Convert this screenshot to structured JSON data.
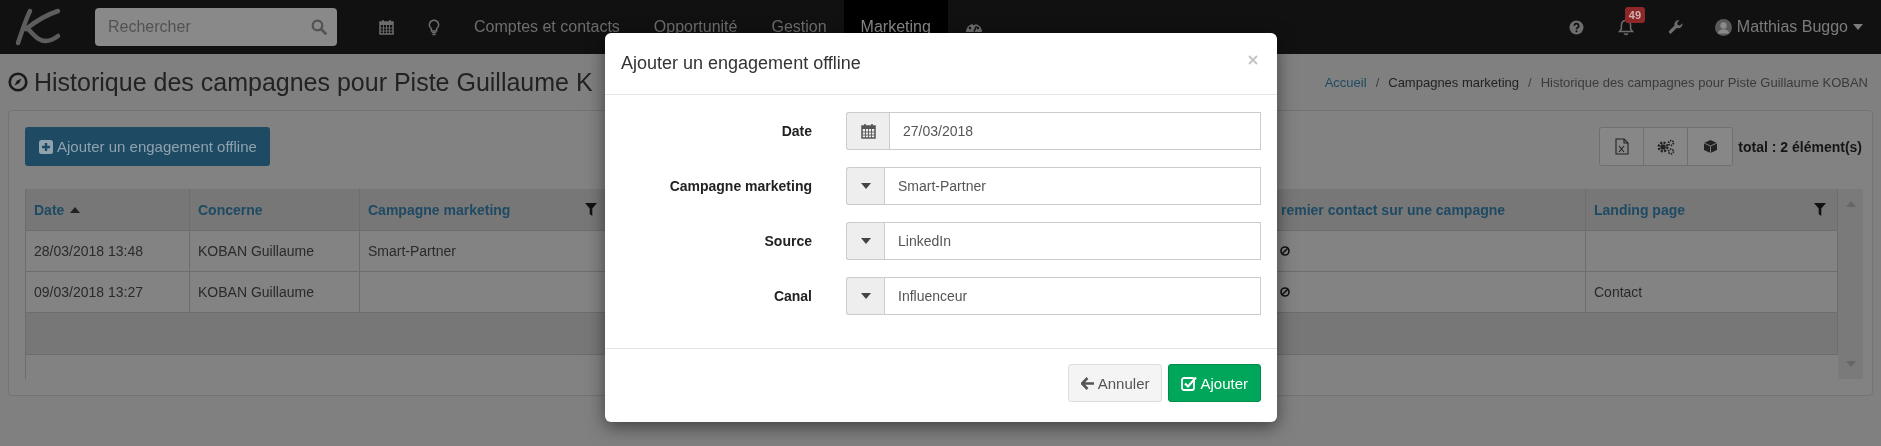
{
  "navbar": {
    "search": {
      "placeholder": "Rechercher"
    },
    "menu": [
      {
        "label": "Comptes et contacts",
        "selected": false
      },
      {
        "label": "Opportunité",
        "selected": false
      },
      {
        "label": "Gestion",
        "selected": false
      },
      {
        "label": "Marketing",
        "selected": true
      }
    ],
    "notifications": "49",
    "user": "Matthias Buggo"
  },
  "page": {
    "title": "Historique des campagnes pour Piste Guillaume K",
    "breadcrumb_separator": "/",
    "breadcrumb": [
      {
        "label": "Accueil",
        "kind": "link"
      },
      {
        "label": "Campagnes marketing",
        "kind": "hover"
      },
      {
        "label": "Historique des campagnes pour Piste Guillaume KOBAN",
        "kind": "current"
      }
    ]
  },
  "toolbar": {
    "add_button": "Ajouter un engagement offline",
    "total": "total : 2 élément(s)"
  },
  "table": {
    "columns": [
      {
        "label": "Date",
        "sorted": true,
        "filter": false
      },
      {
        "label": "Concerne",
        "sorted": false,
        "filter": false
      },
      {
        "label": "Campagne marketing",
        "sorted": false,
        "filter": true
      },
      {
        "label": "remier contact sur une campagne",
        "sorted": false,
        "filter": false
      },
      {
        "label": "Landing page",
        "sorted": false,
        "filter": true
      }
    ],
    "rows": [
      {
        "date": "28/03/2018 13:48",
        "concerne": "KOBAN Guillaume",
        "campagne": "Smart-Partner",
        "premier_contact": false
      },
      {
        "date": "09/03/2018 13:27",
        "concerne": "KOBAN Guillaume",
        "premier_contact": false,
        "landing_page": "Contact"
      }
    ]
  },
  "modal": {
    "title": "Ajouter un engagement offline",
    "fields": [
      {
        "label": "Date",
        "kind": "date",
        "value": "27/03/2018"
      },
      {
        "label": "Campagne marketing",
        "kind": "select",
        "value": "Smart-Partner"
      },
      {
        "label": "Source",
        "kind": "select",
        "value": "LinkedIn"
      },
      {
        "label": "Canal",
        "kind": "select",
        "value": "Influenceur"
      }
    ],
    "buttons": [
      {
        "label": "Annuler",
        "kind": "default"
      },
      {
        "label": "Ajouter",
        "kind": "primary"
      }
    ]
  }
}
